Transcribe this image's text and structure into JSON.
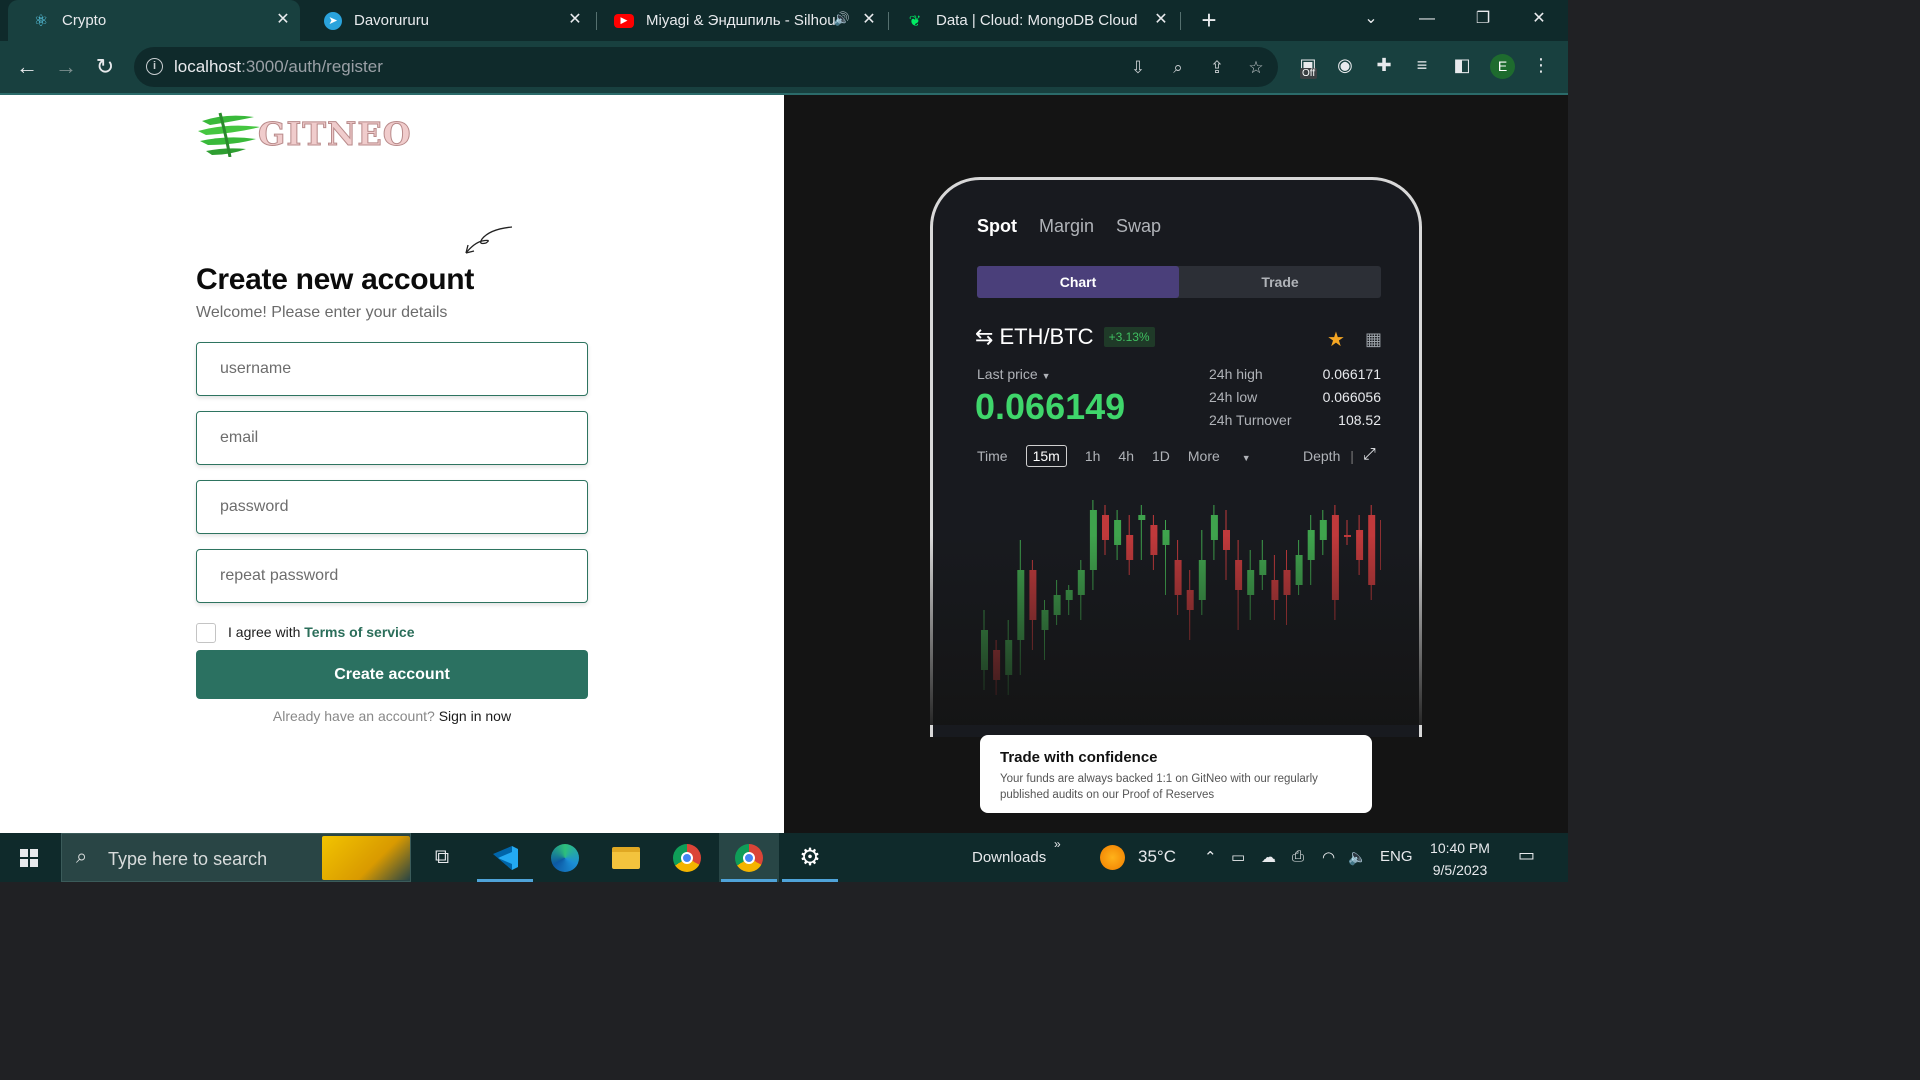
{
  "browser": {
    "tabs": [
      {
        "title": "Crypto",
        "active": true
      },
      {
        "title": "Davorururu",
        "active": false
      },
      {
        "title": "Miyagi & Эндшпиль - Silhou",
        "active": false
      },
      {
        "title": "Data | Cloud: MongoDB Cloud",
        "active": false
      }
    ],
    "url_host": "localhost",
    "url_path": ":3000/auth/register",
    "ext_badge": "Off",
    "profile_initial": "E"
  },
  "brand": {
    "logo_text": "GITNEO"
  },
  "form": {
    "title": "Create new account",
    "subtitle": "Welcome! Please enter your details",
    "username_placeholder": "username",
    "email_placeholder": "email",
    "password_placeholder": "password",
    "repeat_password_placeholder": "repeat password",
    "agree_text": "I agree with ",
    "terms_link": "Terms of service",
    "submit_label": "Create account",
    "signin_prompt": "Already have an account? ",
    "signin_link": "Sign in now"
  },
  "promo": {
    "tabs": [
      "Spot",
      "Margin",
      "Swap"
    ],
    "segment_on": "Chart",
    "segment_off": "Trade",
    "pair": "ETH/BTC",
    "change": "+3.13%",
    "last_price_label": "Last price",
    "last_price": "0.066149",
    "stats": [
      {
        "label": "24h high",
        "value": "0.066171"
      },
      {
        "label": "24h low",
        "value": "0.066056"
      },
      {
        "label": "24h Turnover",
        "value": "108.52"
      }
    ],
    "timeframes": [
      "Time",
      "15m",
      "1h",
      "4h",
      "1D",
      "More"
    ],
    "selected_timeframe": "15m",
    "depth_label": "Depth",
    "confidence_title": "Trade with confidence",
    "confidence_text": "Your funds are always backed 1:1 on GitNeo with our regularly published audits on our Proof of Reserves",
    "up_color": "#3fa34d",
    "down_color": "#c0393b"
  },
  "taskbar": {
    "search_placeholder": "Type here to search",
    "downloads_label": "Downloads",
    "temperature": "35°C",
    "language": "ENG",
    "time": "10:40 PM",
    "date": "9/5/2023"
  }
}
